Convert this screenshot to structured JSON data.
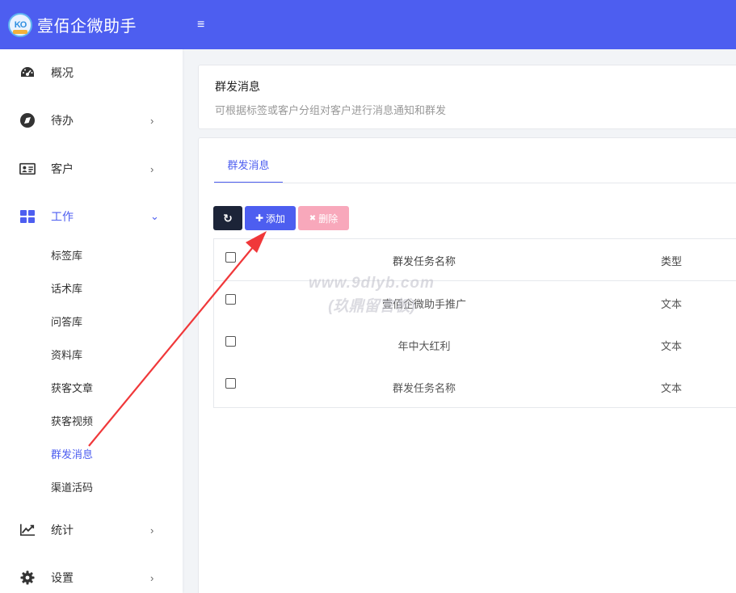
{
  "app": {
    "title": "壹佰企微助手",
    "logo_text": "KO",
    "menu_toggle": "≡",
    "accent": "#4d5ef0"
  },
  "sidebar": {
    "items": [
      {
        "label": "概况",
        "icon": "dashboard-icon",
        "arrow": ""
      },
      {
        "label": "待办",
        "icon": "compass-icon",
        "arrow": "›"
      },
      {
        "label": "客户",
        "icon": "contact-card-icon",
        "arrow": "›"
      },
      {
        "label": "工作",
        "icon": "grid-icon",
        "arrow": "⌄"
      },
      {
        "label": "统计",
        "icon": "line-chart-icon",
        "arrow": "›"
      },
      {
        "label": "设置",
        "icon": "gear-icon",
        "arrow": "›"
      }
    ],
    "sub_items": [
      "标签库",
      "话术库",
      "问答库",
      "资料库",
      "获客文章",
      "获客视频",
      "群发消息",
      "渠道活码"
    ]
  },
  "page": {
    "title": "群发消息",
    "description": "可根据标签或客户分组对客户进行消息通知和群发"
  },
  "tabs": [
    "群发消息"
  ],
  "toolbar": {
    "refresh_icon": "↻",
    "add_icon": "✚",
    "add_label": "添加",
    "delete_icon": "✖",
    "delete_label": "删除"
  },
  "table": {
    "columns": [
      "群发任务名称",
      "类型"
    ],
    "rows": [
      {
        "name": "壹佰企微助手推广",
        "type": "文本"
      },
      {
        "name": "年中大红利",
        "type": "文本"
      },
      {
        "name": "群发任务名称",
        "type": "文本"
      }
    ]
  },
  "watermark": {
    "line1": "www.9dlyb.com",
    "line2": "(玖鼎留言板)"
  }
}
